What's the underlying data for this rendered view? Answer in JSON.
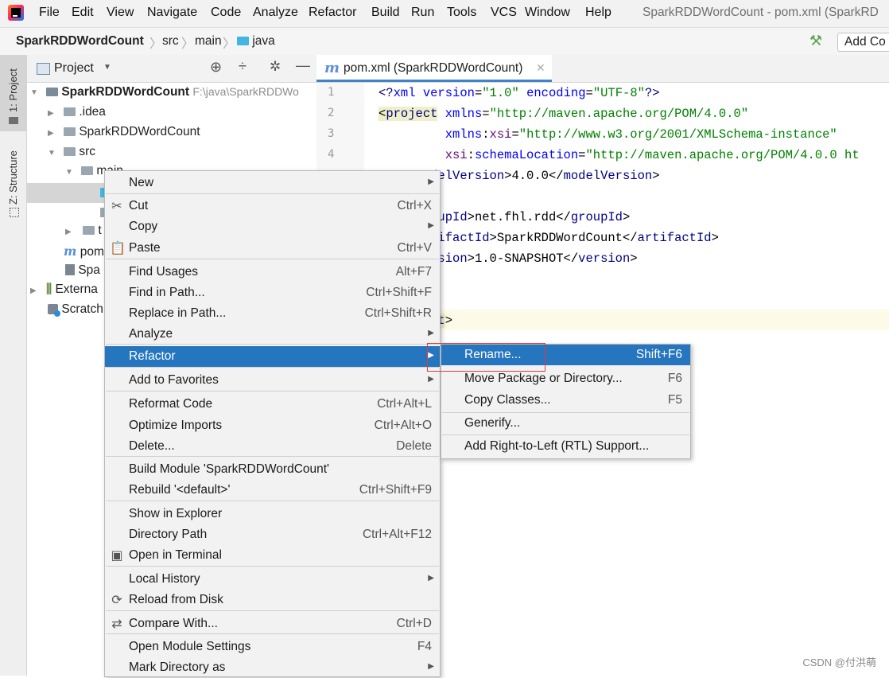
{
  "menubar": {
    "items": [
      "File",
      "Edit",
      "View",
      "Navigate",
      "Code",
      "Analyze",
      "Refactor",
      "Build",
      "Run",
      "Tools",
      "VCS",
      "Window",
      "Help"
    ],
    "window_title": "SparkRDDWordCount - pom.xml (SparkRD"
  },
  "breadcrumb": {
    "project": "SparkRDDWordCount",
    "src": "src",
    "main": "main",
    "java": "java",
    "add_config": "Add Co"
  },
  "stripe": {
    "project_tab": "1: Project",
    "structure_tab": "Z: Structure"
  },
  "project_panel": {
    "title": "Project",
    "tree": {
      "root": "SparkRDDWordCount",
      "root_path": "F:\\java\\SparkRDDWo",
      "idea": ".idea",
      "module": "SparkRDDWordCount",
      "src": "src",
      "main": "main",
      "t": "t",
      "pom": "pom",
      "spa": "Spa",
      "external": "Externa",
      "scratch": "Scratch"
    }
  },
  "editor": {
    "tab_label": "pom.xml (SparkRDDWordCount)",
    "line_numbers": [
      "1",
      "2",
      "3",
      "4"
    ]
  },
  "context_menu": {
    "items": [
      {
        "label": "New",
        "shortcut": "",
        "submenu": true,
        "icon": ""
      },
      {
        "label": "Cut",
        "shortcut": "Ctrl+X",
        "submenu": false,
        "icon": "cut-icon"
      },
      {
        "label": "Copy",
        "shortcut": "",
        "submenu": true,
        "icon": ""
      },
      {
        "label": "Paste",
        "shortcut": "Ctrl+V",
        "submenu": false,
        "icon": "paste-icon"
      },
      {
        "label": "Find Usages",
        "shortcut": "Alt+F7",
        "submenu": false,
        "icon": ""
      },
      {
        "label": "Find in Path...",
        "shortcut": "Ctrl+Shift+F",
        "submenu": false,
        "icon": ""
      },
      {
        "label": "Replace in Path...",
        "shortcut": "Ctrl+Shift+R",
        "submenu": false,
        "icon": ""
      },
      {
        "label": "Analyze",
        "shortcut": "",
        "submenu": true,
        "icon": ""
      },
      {
        "label": "Refactor",
        "shortcut": "",
        "submenu": true,
        "icon": ""
      },
      {
        "label": "Add to Favorites",
        "shortcut": "",
        "submenu": true,
        "icon": ""
      },
      {
        "label": "Reformat Code",
        "shortcut": "Ctrl+Alt+L",
        "submenu": false,
        "icon": ""
      },
      {
        "label": "Optimize Imports",
        "shortcut": "Ctrl+Alt+O",
        "submenu": false,
        "icon": ""
      },
      {
        "label": "Delete...",
        "shortcut": "Delete",
        "submenu": false,
        "icon": ""
      },
      {
        "label": "Build Module 'SparkRDDWordCount'",
        "shortcut": "",
        "submenu": false,
        "icon": ""
      },
      {
        "label": "Rebuild '<default>'",
        "shortcut": "Ctrl+Shift+F9",
        "submenu": false,
        "icon": ""
      },
      {
        "label": "Show in Explorer",
        "shortcut": "",
        "submenu": false,
        "icon": ""
      },
      {
        "label": "Directory Path",
        "shortcut": "Ctrl+Alt+F12",
        "submenu": false,
        "icon": ""
      },
      {
        "label": "Open in Terminal",
        "shortcut": "",
        "submenu": false,
        "icon": "terminal-icon"
      },
      {
        "label": "Local History",
        "shortcut": "",
        "submenu": true,
        "icon": ""
      },
      {
        "label": "Reload from Disk",
        "shortcut": "",
        "submenu": false,
        "icon": "reload-icon"
      },
      {
        "label": "Compare With...",
        "shortcut": "Ctrl+D",
        "submenu": false,
        "icon": "compare-icon"
      },
      {
        "label": "Open Module Settings",
        "shortcut": "F4",
        "submenu": false,
        "icon": ""
      },
      {
        "label": "Mark Directory as",
        "shortcut": "",
        "submenu": true,
        "icon": ""
      }
    ]
  },
  "refactor_submenu": {
    "items": [
      {
        "label": "Rename...",
        "shortcut": "Shift+F6"
      },
      {
        "label": "Move Package or Directory...",
        "shortcut": "F6"
      },
      {
        "label": "Copy Classes...",
        "shortcut": "F5"
      },
      {
        "label": "Generify...",
        "shortcut": ""
      },
      {
        "label": "Add Right-to-Left (RTL) Support...",
        "shortcut": ""
      }
    ]
  },
  "watermark": "CSDN @付洪萌",
  "colors": {
    "selection": "#2675bf",
    "highlight_box": "#e03c3c"
  }
}
